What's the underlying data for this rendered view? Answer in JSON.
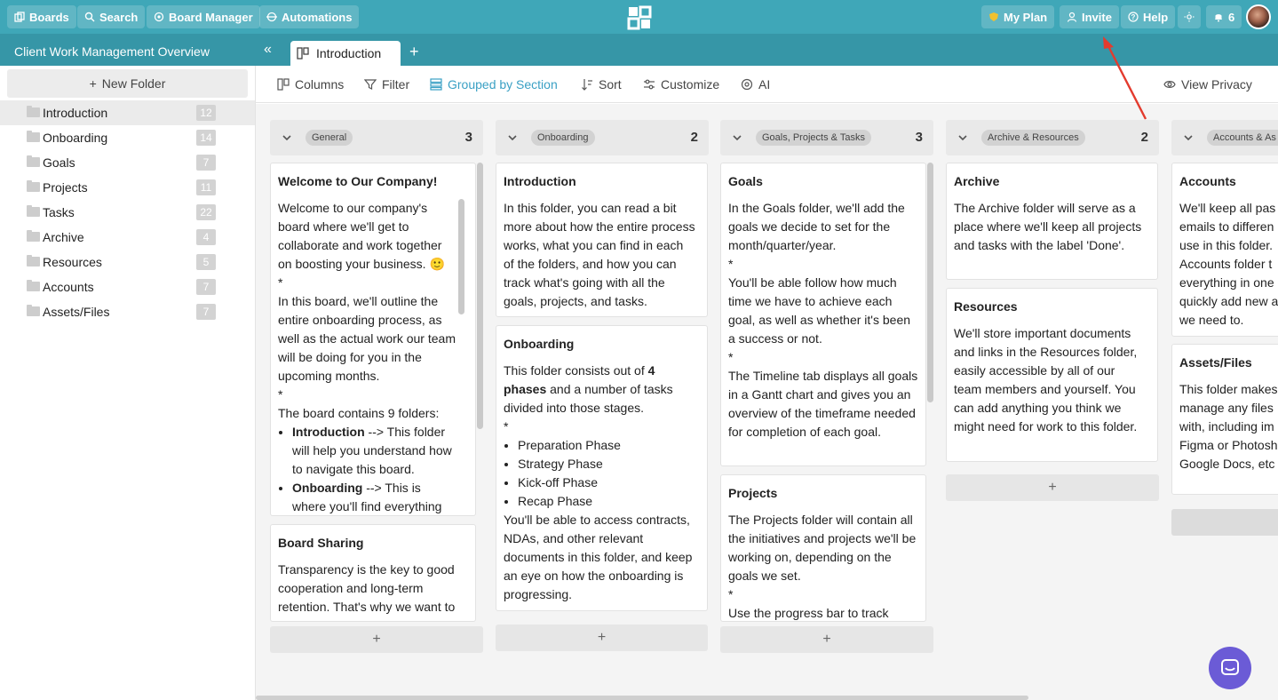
{
  "topbar": {
    "boards": "Boards",
    "search": "Search",
    "board_manager": "Board Manager",
    "automations": "Automations",
    "my_plan": "My Plan",
    "invite": "Invite",
    "help": "Help",
    "notif_count": "6",
    "accent": "#3fa7b8"
  },
  "subbar": {
    "board_title": "Client Work Management Overview",
    "tab_label": "Introduction",
    "add_tab": "+",
    "collapse": "«"
  },
  "sidebar": {
    "new_folder": "New Folder",
    "folders": [
      {
        "label": "Introduction",
        "count": "12"
      },
      {
        "label": "Onboarding",
        "count": "14"
      },
      {
        "label": "Goals",
        "count": "7"
      },
      {
        "label": "Projects",
        "count": "11"
      },
      {
        "label": "Tasks",
        "count": "22"
      },
      {
        "label": "Archive",
        "count": "4"
      },
      {
        "label": "Resources",
        "count": "5"
      },
      {
        "label": "Accounts",
        "count": "7"
      },
      {
        "label": "Assets/Files",
        "count": "7"
      }
    ]
  },
  "toolbar": {
    "columns": "Columns",
    "filter": "Filter",
    "grouped": "Grouped by Section",
    "sort": "Sort",
    "customize": "Customize",
    "ai": "AI",
    "view_privacy": "View Privacy"
  },
  "columns": [
    {
      "section": "General",
      "count": "3",
      "cards": [
        {
          "title": "Welcome to Our Company!",
          "p1": "Welcome to our company's board where we'll get to collaborate and work together on boosting your business. 🙂",
          "star1": "*",
          "p2": "In this board, we'll outline the entire onboarding process, as well as the actual work our team will be doing for you in the upcoming months.",
          "star2": "*",
          "p3": "The board contains 9 folders:",
          "li1_bold": "Introduction",
          "li1_rest": " --> This folder will help you understand how to navigate this board.",
          "li2_bold": "Onboarding",
          "li2_rest": " --> This is where you'll find everything"
        },
        {
          "title": "Board Sharing",
          "p1": "Transparency is the key to good cooperation and long-term retention. That's why we want to"
        }
      ],
      "add": "+"
    },
    {
      "section": "Onboarding",
      "count": "2",
      "cards": [
        {
          "title": "Introduction",
          "p1": "In this folder, you can read a bit more about how the entire process works, what you can find in each of the folders, and how you can track what's going with all the goals, projects, and tasks."
        },
        {
          "title": "Onboarding",
          "p1a": "This folder consists out of ",
          "p1b": "4 phases",
          "p1c": " and a number of tasks divided into those stages.",
          "star": "*",
          "li": [
            "Preparation Phase",
            "Strategy Phase",
            "Kick-off Phase",
            "Recap Phase"
          ],
          "p2": "You'll be able to access contracts, NDAs, and other relevant documents in this folder, and keep an eye on how the onboarding is progressing."
        }
      ],
      "add": "+"
    },
    {
      "section": "Goals, Projects & Tasks",
      "count": "3",
      "cards": [
        {
          "title": "Goals",
          "p1": "In the Goals folder, we'll add the goals we decide to set for the month/quarter/year.",
          "star1": "*",
          "p2": "You'll be able follow how much time we have to achieve each goal, as well as whether it's been a success or not.",
          "star2": "*",
          "p3": "The Timeline tab displays all goals in a Gantt chart and gives you an overview of the timeframe needed for completion of each goal."
        },
        {
          "title": "Projects",
          "p1": "The Projects folder will contain all the initiatives and projects we'll be working on, depending on the goals we set.",
          "star": "*",
          "p2": "Use the progress bar to track"
        }
      ],
      "add": "+"
    },
    {
      "section": "Archive & Resources",
      "count": "2",
      "cards": [
        {
          "title": "Archive",
          "p1": "The Archive folder will serve as a place where we'll keep all projects and tasks with the label 'Done'."
        },
        {
          "title": "Resources",
          "p1": "We'll store important documents and links in the Resources folder, easily accessible by all of our team members and yourself. You can add anything you think we might need for work to this folder."
        }
      ],
      "add": "+"
    },
    {
      "section": "Accounts & As",
      "cards": [
        {
          "title": "Accounts",
          "lines": [
            "We'll keep all pas",
            "emails to differen",
            "use in this folder.",
            "Accounts folder t",
            "everything in one",
            "quickly add new a",
            "we need to."
          ]
        },
        {
          "title": "Assets/Files",
          "lines": [
            "This folder makes",
            "manage any files",
            "with, including im",
            "Figma or Photosh",
            "Google Docs, etc"
          ]
        }
      ],
      "add": "+"
    }
  ]
}
